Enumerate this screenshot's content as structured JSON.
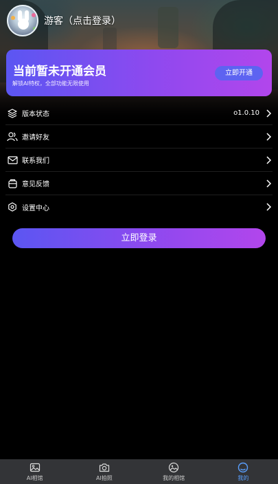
{
  "header": {
    "username": "游客（点击登录）"
  },
  "vip": {
    "title": "当前暂未开通会员",
    "subtitle": "解锁AI特权，全部功能无限使用",
    "button_label": "立即开通"
  },
  "menu": {
    "items": [
      {
        "label": "版本状态",
        "value": "o1.0.10",
        "icon": "layers-icon"
      },
      {
        "label": "邀请好友",
        "value": "",
        "icon": "users-icon"
      },
      {
        "label": "联系我们",
        "value": "",
        "icon": "mail-icon"
      },
      {
        "label": "意见反馈",
        "value": "",
        "icon": "feedback-icon"
      },
      {
        "label": "设置中心",
        "value": "",
        "icon": "settings-icon"
      }
    ]
  },
  "login_button": "立即登录",
  "tabbar": {
    "active_color": "#5aa0ff",
    "tabs": [
      {
        "label": "AI相馆",
        "icon": "image-icon",
        "active": false
      },
      {
        "label": "AI拍照",
        "icon": "camera-icon",
        "active": false
      },
      {
        "label": "我的相馆",
        "icon": "album-icon",
        "active": false
      },
      {
        "label": "我的",
        "icon": "profile-ring-icon",
        "active": true
      }
    ]
  },
  "colors": {
    "gradient_start": "#5b56f2",
    "gradient_end": "#b246ec",
    "background": "#000000",
    "tabbar": "#333437"
  }
}
